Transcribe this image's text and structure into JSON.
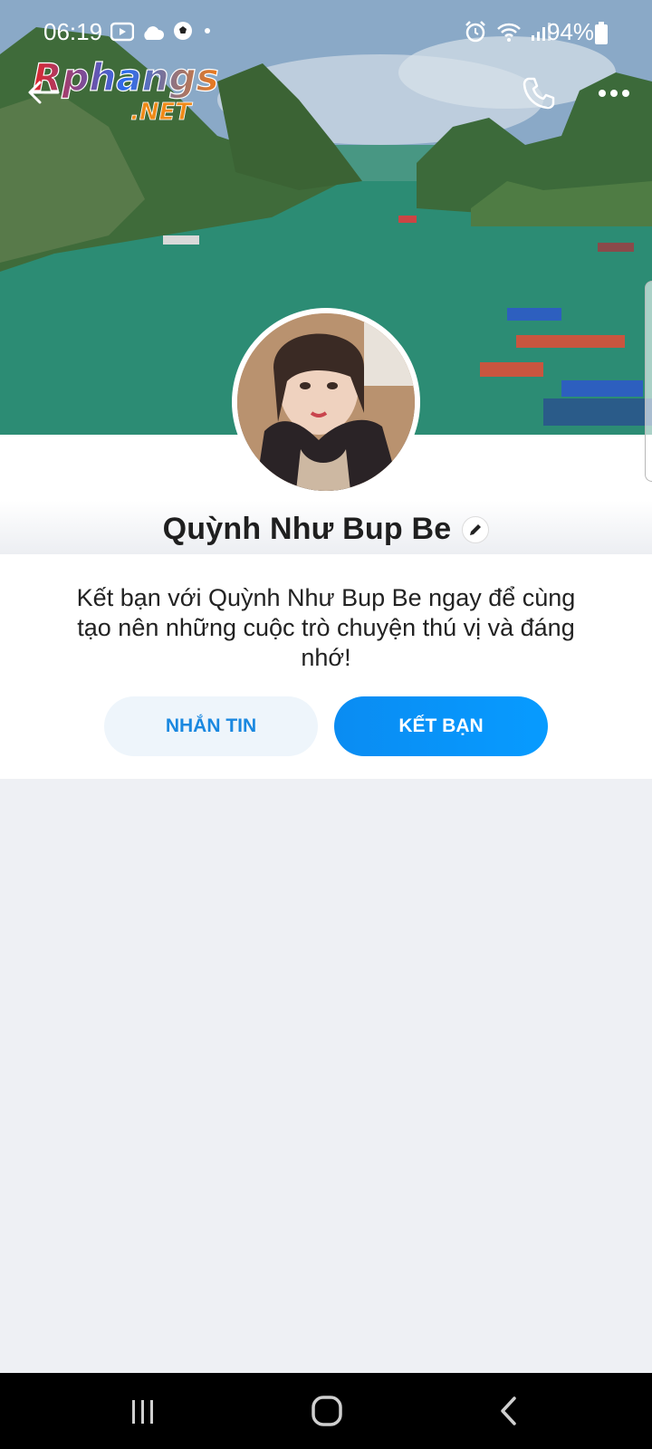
{
  "status_bar": {
    "time": "06:19",
    "battery_percent": "94%",
    "left_icons": [
      "youtube-icon",
      "cloud-icon",
      "soccer-ball-icon",
      "dot-icon"
    ],
    "right_icons": [
      "alarm-icon",
      "wifi-icon",
      "signal-icon",
      "battery-icon"
    ]
  },
  "header": {
    "watermark_top": "Rphangs",
    "watermark_bottom": ".NET",
    "icons": [
      "back-arrow-icon",
      "phone-icon",
      "more-icon"
    ]
  },
  "profile": {
    "name": "Quỳnh Như Bup Be",
    "name_icon": "pencil-icon"
  },
  "card": {
    "intro_text": "Kết bạn với Quỳnh Như Bup Be ngay để cùng tạo nên những cuộc trò chuyện thú vị và đáng nhớ!",
    "message_button": "NHẮN TIN",
    "add_friend_button": "KẾT BẠN"
  },
  "colors": {
    "accent": "#0a8cf2",
    "secondary_button_bg": "#eef5fb",
    "page_bg": "#eef0f4"
  },
  "nav_bar": {
    "icons": [
      "recent-apps-icon",
      "home-icon",
      "back-icon"
    ]
  }
}
